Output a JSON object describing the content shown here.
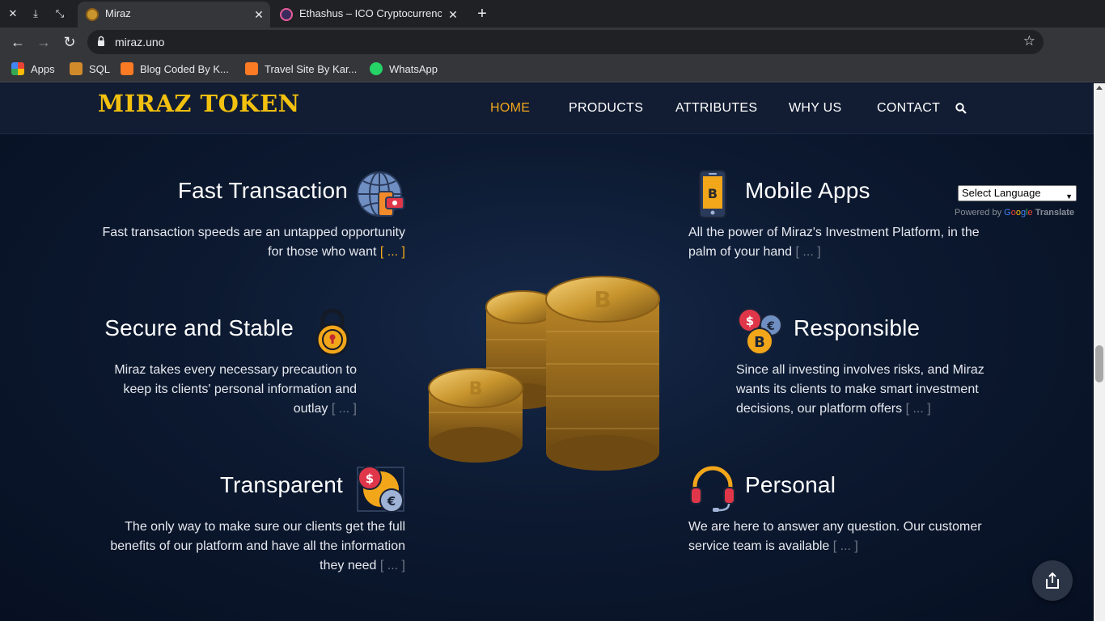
{
  "browser": {
    "tabs": [
      {
        "title": "Miraz",
        "active": true
      },
      {
        "title": "Ethashus – ICO Cryptocurrency",
        "active": false
      }
    ],
    "url": "miraz.uno",
    "bookmarks": [
      {
        "label": "Apps",
        "icon": "apps-grid-icon"
      },
      {
        "label": "SQL",
        "icon": "sql-icon"
      },
      {
        "label": "Blog Coded By K...",
        "icon": "xampp-icon"
      },
      {
        "label": "Travel Site By Kar...",
        "icon": "xampp-icon"
      },
      {
        "label": "WhatsApp",
        "icon": "whatsapp-icon"
      }
    ]
  },
  "site": {
    "logo": "MIRAZ TOKEN",
    "menu": [
      "HOME",
      "PRODUCTS",
      "ATTRIBUTES",
      "WHY US",
      "CONTACT"
    ],
    "active_menu": "HOME"
  },
  "features": {
    "fast": {
      "title": "Fast Transaction",
      "desc": "Fast transaction speeds are an untapped opportunity for those who want",
      "more": "[ ... ]",
      "icon": "globe-mobile-icon"
    },
    "mobile": {
      "title": "Mobile Apps",
      "desc": "All the power of Miraz's Investment Platform, in the palm of your hand",
      "more": "[ ... ]",
      "icon": "smartphone-bitcoin-icon"
    },
    "secure": {
      "title": "Secure and Stable",
      "desc": "Miraz takes every necessary precaution to keep its clients' personal information and outlay",
      "more": "[ ... ]",
      "icon": "padlock-icon"
    },
    "responsible": {
      "title": "Responsible",
      "desc": "Since all investing involves risks, and Miraz wants its clients to make smart investment decisions, our platform offers",
      "more": "[ ... ]",
      "icon": "currency-coins-icon"
    },
    "transparent": {
      "title": "Transparent",
      "desc": "The only way to make sure our clients get the full benefits of our platform and have all the information they need",
      "more": "[ ... ]",
      "icon": "currency-exchange-icon"
    },
    "personal": {
      "title": "Personal",
      "desc": "We are here to answer any question. Our customer service team is available",
      "more": "[ ... ]",
      "icon": "headset-icon"
    }
  },
  "translate": {
    "select_label": "Select Language",
    "powered_by": "Powered by",
    "google": "Google",
    "translate_word": "Translate"
  },
  "colors": {
    "accent": "#f2a61a",
    "logo": "#f2c00f",
    "background": "#0a1426"
  }
}
